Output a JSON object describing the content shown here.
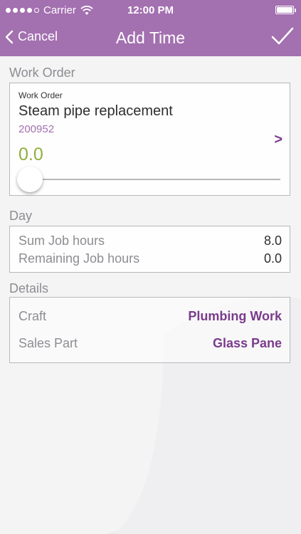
{
  "status_bar": {
    "carrier": "Carrier",
    "time": "12:00 PM"
  },
  "nav": {
    "back_label": "Cancel",
    "title": "Add Time"
  },
  "work_order": {
    "section_label": "Work Order",
    "field_label": "Work Order",
    "title": "Steam pipe replacement",
    "number": "200952",
    "hours": "0.0",
    "arrow": ">"
  },
  "day": {
    "section_label": "Day",
    "rows": [
      {
        "label": "Sum Job hours",
        "value": "8.0"
      },
      {
        "label": "Remaining Job hours",
        "value": "0.0"
      }
    ]
  },
  "details": {
    "section_label": "Details",
    "rows": [
      {
        "label": "Craft",
        "value": "Plumbing Work"
      },
      {
        "label": "Sales Part",
        "value": "Glass Pane"
      }
    ]
  },
  "colors": {
    "header": "#a370b0",
    "accent_value": "#7b3b8c",
    "hours_green": "#8fb03c"
  }
}
